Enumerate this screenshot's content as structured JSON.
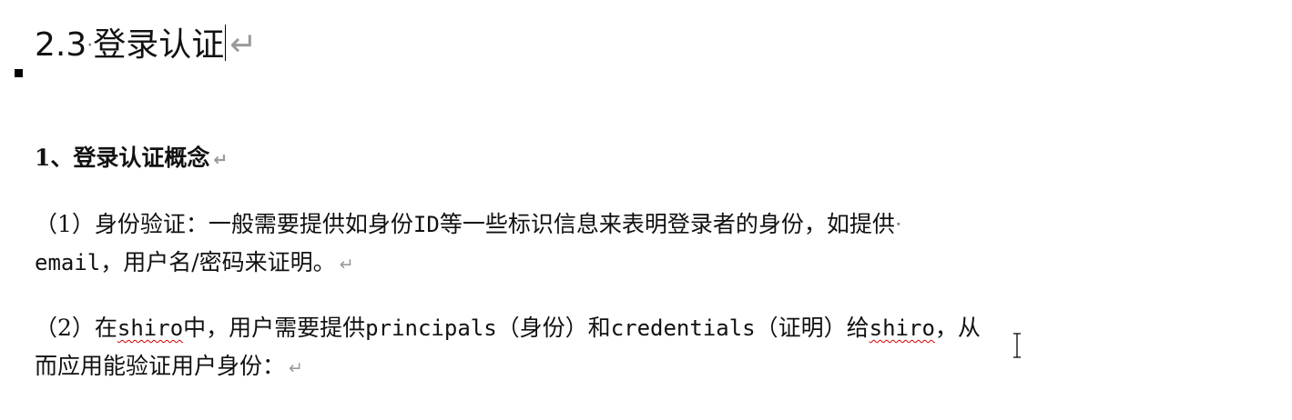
{
  "heading": {
    "number": "2.3",
    "separator": "·",
    "title": "登录认证",
    "mark": "↵"
  },
  "section": {
    "title": "1、登录认证概念",
    "mark": "↵"
  },
  "paragraphs": [
    {
      "line1": [
        {
          "t": "（1）身份验证：一般需要提供如身份",
          "style": "cn"
        },
        {
          "t": "ID",
          "style": "mono"
        },
        {
          "t": "等一些标识信息来表明登录者的身份，如提供",
          "style": "cn"
        },
        {
          "t": "·",
          "style": "dot"
        }
      ],
      "line2": [
        {
          "t": "email",
          "style": "mono"
        },
        {
          "t": "，用户名/密码来证明。",
          "style": "cn"
        }
      ],
      "mark": "↵"
    },
    {
      "line1": [
        {
          "t": "（2）在",
          "style": "cn"
        },
        {
          "t": "shiro",
          "style": "mono-spell"
        },
        {
          "t": "中，用户需要提供",
          "style": "cn"
        },
        {
          "t": "principals",
          "style": "mono"
        },
        {
          "t": "（身份）和",
          "style": "cn"
        },
        {
          "t": "credentials",
          "style": "mono"
        },
        {
          "t": "（证明）给",
          "style": "cn"
        },
        {
          "t": "shiro",
          "style": "mono-spell"
        },
        {
          "t": "，从",
          "style": "cn"
        }
      ],
      "line2": [
        {
          "t": "而应用能验证用户身份：",
          "style": "cn"
        }
      ],
      "mark": "↵"
    }
  ]
}
